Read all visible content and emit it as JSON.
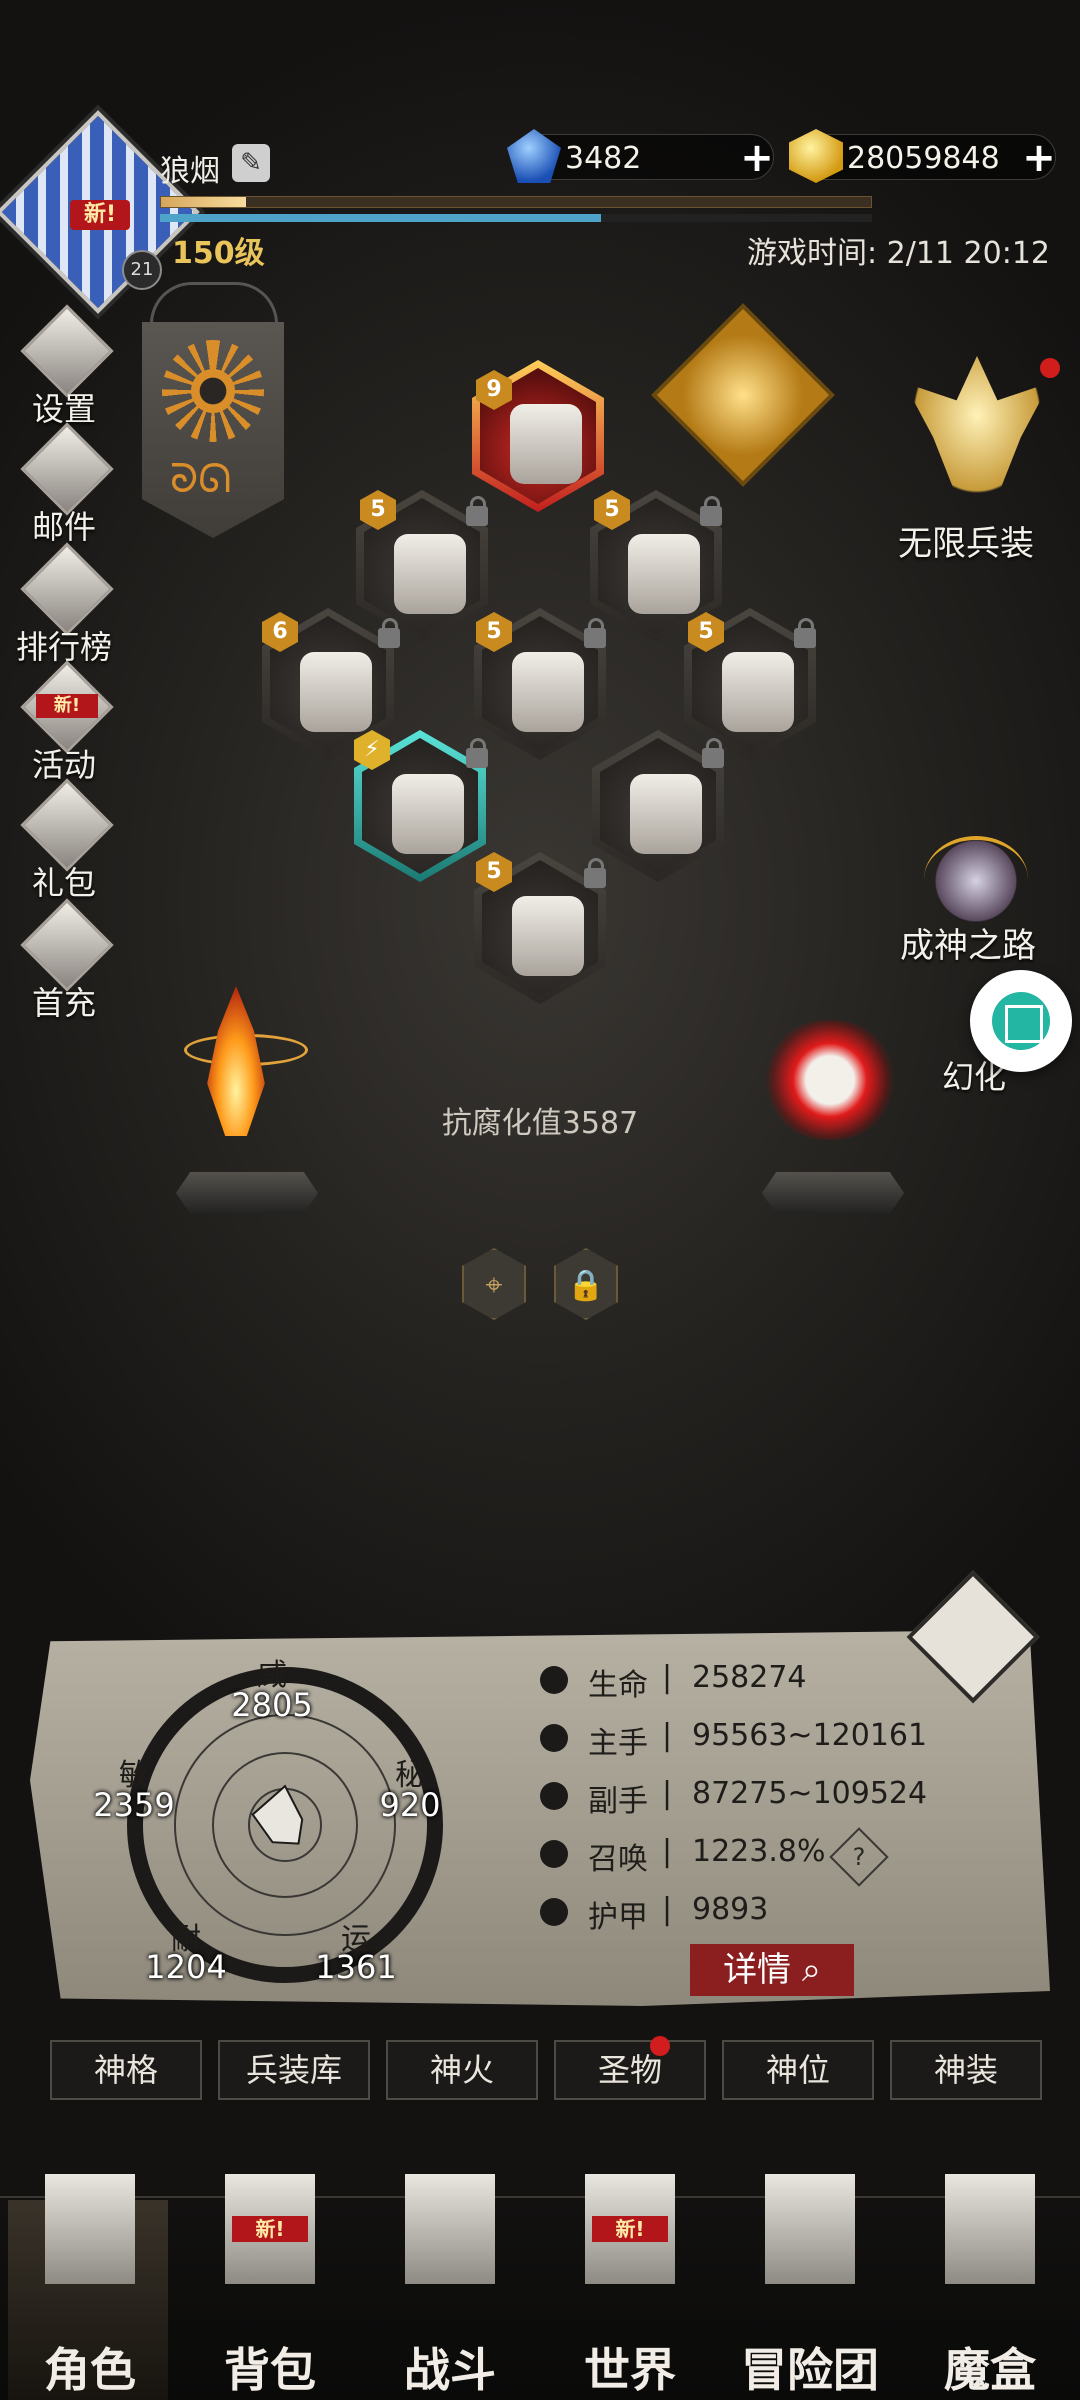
{
  "player": {
    "name": "狼烟",
    "level_label": "150级",
    "avatar_new": "新!",
    "avatar_sub_level": "21",
    "exp_progress": 0.12,
    "mp_progress": 0.62,
    "game_time": "游戏时间: 2/11 20:12"
  },
  "currency": {
    "gems": "3482",
    "gold": "28059848"
  },
  "left_menu": [
    {
      "label": "设置",
      "icon": "gear-icon"
    },
    {
      "label": "邮件",
      "icon": "mail-icon"
    },
    {
      "label": "排行榜",
      "icon": "ranking-icon"
    },
    {
      "label": "活动",
      "icon": "event-icon",
      "badge": "新!"
    },
    {
      "label": "礼包",
      "icon": "gift-icon"
    },
    {
      "label": "首充",
      "icon": "first-recharge-icon"
    }
  ],
  "right_menu": {
    "infinite_gear": "无限兵装",
    "path_to_godhood": "成神之路",
    "illusion": "幻化"
  },
  "equipment": [
    {
      "slot": "crown",
      "level": "9"
    },
    {
      "slot": "gauntlet",
      "level": "5"
    },
    {
      "slot": "ring",
      "level": "5"
    },
    {
      "slot": "belt",
      "level": "6"
    },
    {
      "slot": "armor",
      "level": "5"
    },
    {
      "slot": "cloak",
      "level": "5"
    },
    {
      "slot": "weapon-left",
      "level": ""
    },
    {
      "slot": "weapon-right",
      "level": ""
    },
    {
      "slot": "boots",
      "level": "5"
    }
  ],
  "corrosion": "抗腐化值3587",
  "attributes": {
    "wei": {
      "name": "威",
      "value": "2805"
    },
    "mi": {
      "name": "秘",
      "value": "920"
    },
    "yun": {
      "name": "运",
      "value": "1361"
    },
    "nai": {
      "name": "耐",
      "value": "1204"
    },
    "min": {
      "name": "敏",
      "value": "2359"
    }
  },
  "stats": [
    {
      "name": "生命",
      "value": "258274",
      "icon": "heart-icon"
    },
    {
      "name": "主手",
      "value": "95563~120161",
      "icon": "main-hand-icon"
    },
    {
      "name": "副手",
      "value": "87275~109524",
      "icon": "off-hand-icon"
    },
    {
      "name": "召唤",
      "value": "1223.8%",
      "icon": "summon-icon"
    },
    {
      "name": "护甲",
      "value": "9893",
      "icon": "armor-icon"
    }
  ],
  "stat_separator": "|",
  "details_button": "详情",
  "help_glyph": "?",
  "sub_tabs": [
    "神格",
    "兵装库",
    "神火",
    "圣物",
    "神位",
    "神装"
  ],
  "bottom_nav": [
    {
      "label": "角色",
      "icon": "helmet-icon"
    },
    {
      "label": "背包",
      "icon": "backpack-icon",
      "badge": "新!"
    },
    {
      "label": "战斗",
      "icon": "sword-shield-icon"
    },
    {
      "label": "世界",
      "icon": "scroll-map-icon",
      "badge": "新!"
    },
    {
      "label": "冒险团",
      "icon": "castle-icon"
    },
    {
      "label": "魔盒",
      "icon": "cube-box-icon"
    }
  ],
  "colors": {
    "accent_gold": "#e8c45a",
    "alert_red": "#d11d1d",
    "teal_button": "#23b6a3"
  }
}
